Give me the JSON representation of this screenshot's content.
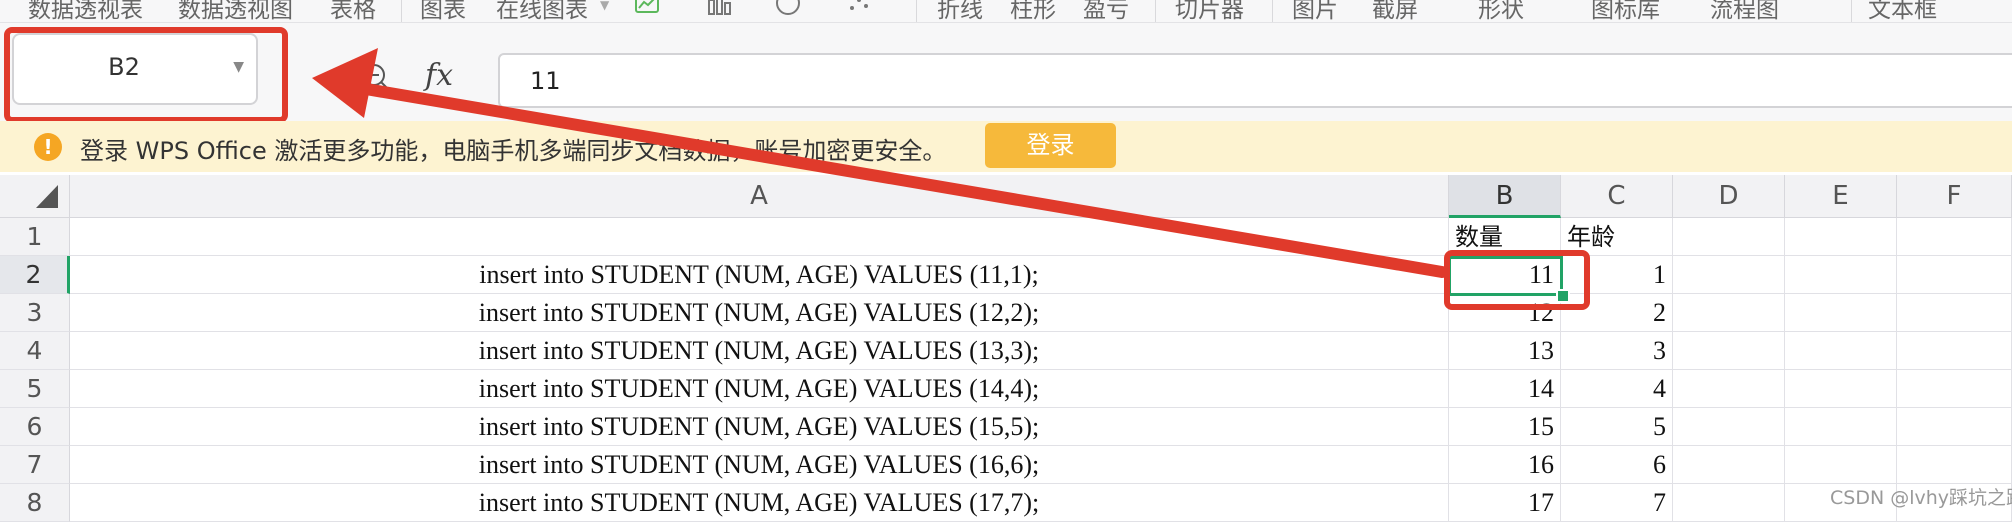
{
  "toolbar": {
    "items": [
      "数据透视表",
      "数据透视图",
      "表格",
      "图表",
      "在线图表",
      "折线",
      "柱形",
      "盈亏",
      "切片器",
      "图片",
      "截屏",
      "形状",
      "图标库",
      "流程图",
      "文本框"
    ]
  },
  "formula_bar": {
    "name_box": "B2",
    "fx_label": "fx",
    "formula": "11"
  },
  "banner": {
    "message": "登录 WPS Office 激活更多功能，电脑手机多端同步文档数据，账号加密更安全。",
    "login_label": "登录"
  },
  "sheet": {
    "columns": [
      "A",
      "B",
      "C",
      "D",
      "E",
      "F"
    ],
    "rows": [
      "1",
      "2",
      "3",
      "4",
      "5",
      "6",
      "7",
      "8"
    ],
    "header_row": {
      "b": "数量",
      "c": "年龄"
    },
    "data": [
      {
        "a": "insert into  STUDENT (NUM,  AGE) VALUES (11,1);",
        "b": "11",
        "c": "1"
      },
      {
        "a": "insert into  STUDENT (NUM,  AGE) VALUES (12,2);",
        "b": "12",
        "c": "2"
      },
      {
        "a": "insert into  STUDENT (NUM,  AGE) VALUES (13,3);",
        "b": "13",
        "c": "3"
      },
      {
        "a": "insert into  STUDENT (NUM,  AGE) VALUES (14,4);",
        "b": "14",
        "c": "4"
      },
      {
        "a": "insert into  STUDENT (NUM,  AGE) VALUES (15,5);",
        "b": "15",
        "c": "5"
      },
      {
        "a": "insert into  STUDENT (NUM,  AGE) VALUES (16,6);",
        "b": "16",
        "c": "6"
      },
      {
        "a": "insert into  STUDENT (NUM,  AGE) VALUES (17,7);",
        "b": "17",
        "c": "7"
      }
    ],
    "selected_cell": "B2"
  },
  "watermark": "CSDN @lvhy踩坑之路",
  "colors": {
    "selection": "#21a366",
    "annotation": "#e03a2b",
    "banner_bg": "#fdf3d1",
    "login_button": "#f6b93b"
  },
  "icons": [
    "insert-chart-icon",
    "ellipse-icon",
    "scatter-icon",
    "zoom-icon",
    "warning-icon",
    "name-box-dropdown-icon"
  ]
}
